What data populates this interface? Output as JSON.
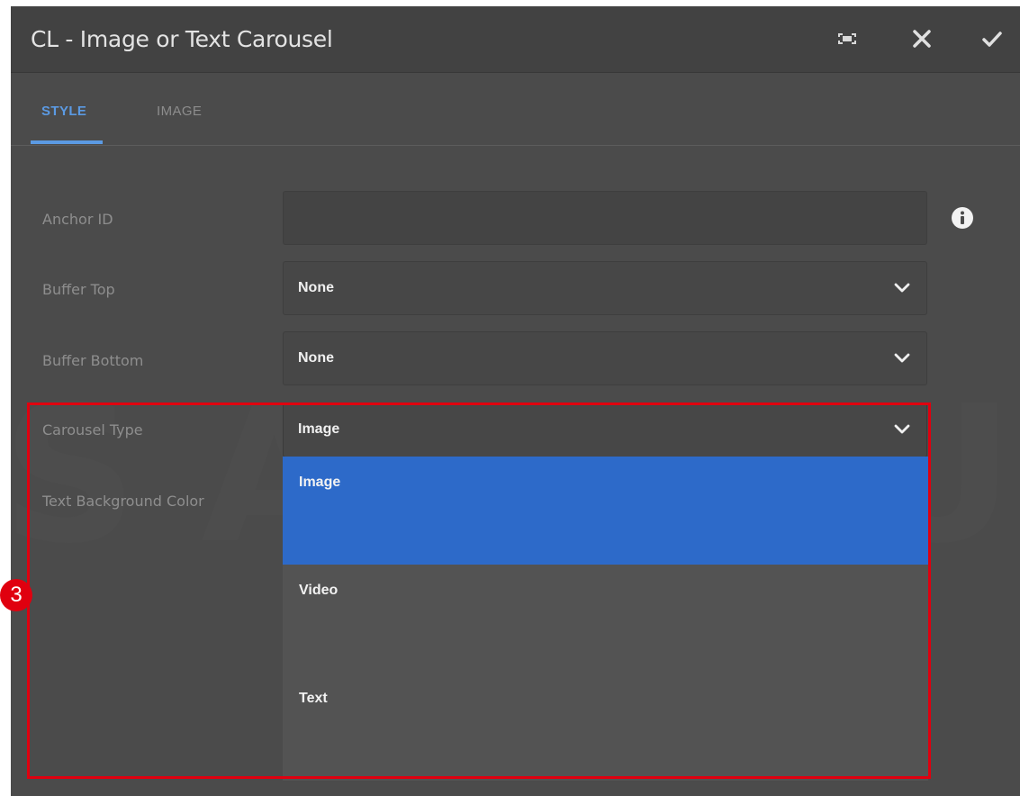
{
  "dialog": {
    "title": "CL - Image or Text Carousel",
    "toolbar": {
      "fullscreen_icon": "fullscreen-icon",
      "close_icon": "close-icon",
      "confirm_icon": "checkmark-icon"
    }
  },
  "tabs": [
    {
      "label": "STYLE",
      "active": true
    },
    {
      "label": "IMAGE",
      "active": false
    }
  ],
  "watermark": "SAMSUNG",
  "fields": {
    "anchor_id": {
      "label": "Anchor ID",
      "value": "",
      "info_icon": "info-icon"
    },
    "buffer_top": {
      "label": "Buffer Top",
      "value": "None"
    },
    "buffer_bottom": {
      "label": "Buffer Bottom",
      "value": "None"
    },
    "carousel_type": {
      "label": "Carousel Type",
      "value": "Image"
    },
    "text_bg_color": {
      "label": "Text Background Color"
    }
  },
  "dropdown": {
    "options": [
      "Image",
      "Video",
      "Text"
    ],
    "selected": "Image"
  },
  "annotation": {
    "step": "3"
  },
  "colors": {
    "accent": "#5b9ae3",
    "selected_option": "#2d6ac9",
    "highlight": "#e0000f"
  }
}
